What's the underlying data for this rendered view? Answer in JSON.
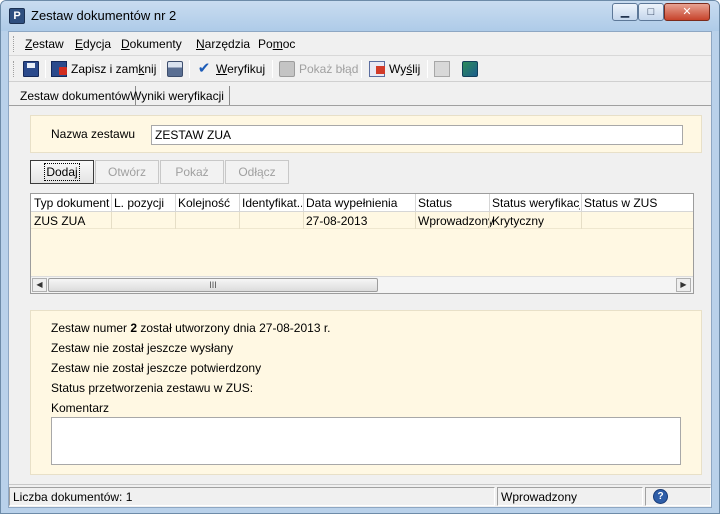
{
  "window": {
    "title": "Zestaw dokumentów nr 2",
    "app_icon_letter": "P",
    "controls": {
      "minimize": "▁",
      "maximize": "□",
      "close": "✕"
    }
  },
  "menu": {
    "items": [
      {
        "pre": "",
        "u": "Z",
        "post": "estaw"
      },
      {
        "pre": "",
        "u": "E",
        "post": "dycja"
      },
      {
        "pre": "",
        "u": "D",
        "post": "okumenty"
      },
      {
        "pre": "",
        "u": "N",
        "post": "arzędzia"
      },
      {
        "pre": "Po",
        "u": "m",
        "post": "oc"
      }
    ]
  },
  "toolbar": {
    "save_icon": "save-icon",
    "save_close": {
      "pre": "Zapisz i zam",
      "u": "k",
      "post": "nij"
    },
    "print_icon": "print-icon",
    "verify": {
      "pre": "",
      "u": "W",
      "post": "eryfikuj"
    },
    "show_error": "Pokaż błąd",
    "send": {
      "pre": "Wy",
      "u": "ś",
      "post": "lij"
    }
  },
  "tabs": {
    "items": [
      "Zestaw dokumentów",
      "Wyniki weryfikacji"
    ],
    "active": 0
  },
  "set_name": {
    "label": "Nazwa zestawu",
    "value": "ZESTAW ZUA"
  },
  "buttons": {
    "add": "Dodaj",
    "open": "Otwórz",
    "show": "Pokaż",
    "detach": "Odłącz"
  },
  "table": {
    "columns": [
      "Typ dokumentu",
      "L. pozycji",
      "Kolejność",
      "Identyfikat...",
      "Data wypełnienia",
      "Status",
      "Status weryfikacji",
      "Status w ZUS"
    ],
    "rows": [
      [
        "ZUS ZUA",
        "",
        "",
        "",
        "27-08-2013",
        "Wprowadzony",
        "Krytyczny",
        ""
      ]
    ],
    "scroll_left": "◀",
    "scroll_right": "▶",
    "scroll_thumb": "III"
  },
  "info": {
    "line1_pre": "Zestaw numer ",
    "line1_num": "2",
    "line1_post": " został utworzony dnia 27-08-2013 r.",
    "line2": "Zestaw nie został jeszcze wysłany",
    "line3": "Zestaw nie został jeszcze potwierdzony",
    "line4": "Status przetworzenia zestawu w ZUS:",
    "comment_label": "Komentarz",
    "comment_value": ""
  },
  "statusbar": {
    "count": "Liczba dokumentów: 1",
    "status": "Wprowadzony",
    "help": "?"
  }
}
